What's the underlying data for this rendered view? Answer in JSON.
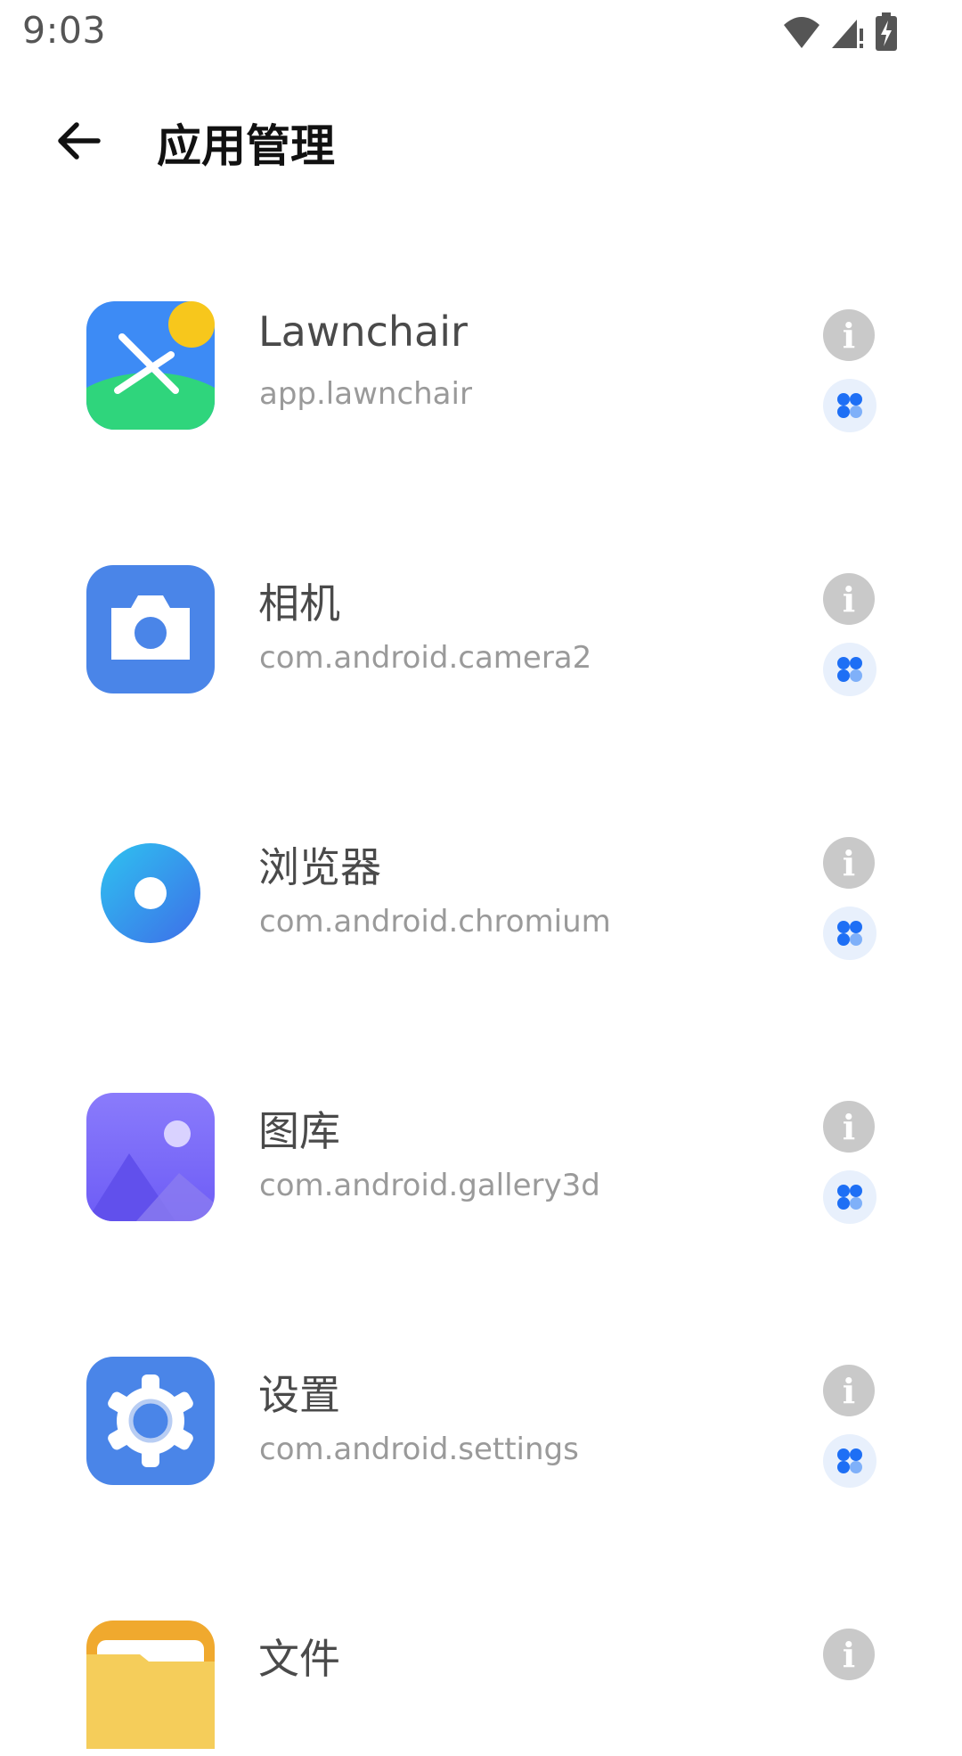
{
  "status_bar": {
    "time": "9:03"
  },
  "header": {
    "title": "应用管理"
  },
  "apps": [
    {
      "name": "Lawnchair",
      "package": "app.lawnchair",
      "icon": "lawnchair-icon"
    },
    {
      "name": "相机",
      "package": "com.android.camera2",
      "icon": "camera-app-icon"
    },
    {
      "name": "浏览器",
      "package": "com.android.chromium",
      "icon": "browser-app-icon"
    },
    {
      "name": "图库",
      "package": "com.android.gallery3d",
      "icon": "gallery-app-icon"
    },
    {
      "name": "设置",
      "package": "com.android.settings",
      "icon": "settings-app-icon"
    },
    {
      "name": "文件",
      "package": "",
      "icon": "files-app-icon"
    }
  ],
  "colors": {
    "accent": "#1e6ff5",
    "info_icon": "#c9c9c9",
    "manage_bg": "#e8f0fc"
  }
}
